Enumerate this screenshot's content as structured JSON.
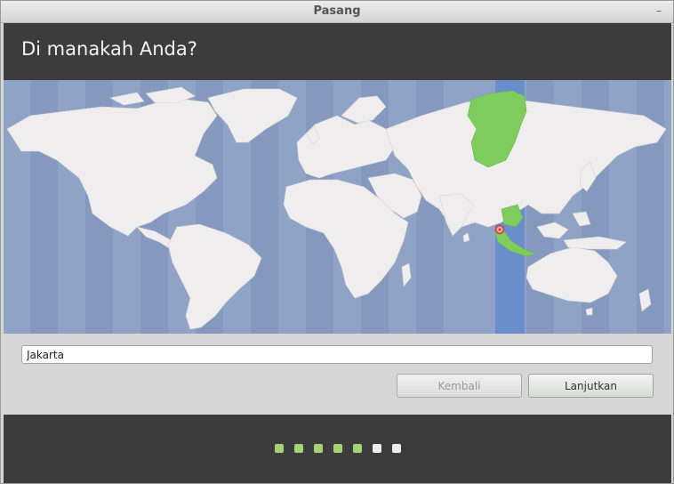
{
  "window": {
    "title": "Pasang",
    "close_glyph": "–"
  },
  "header": {
    "title": "Di manakah Anda?"
  },
  "map": {
    "selected_city": "Jakarta",
    "highlight_color": "#7fcc5e",
    "timezone_band_color": "#6a8ecb"
  },
  "location": {
    "value": "Jakarta"
  },
  "buttons": {
    "back": "Kembali",
    "next": "Lanjutkan"
  },
  "progress": {
    "total_steps": 7,
    "completed_steps": 5,
    "done_color": "#a4d274",
    "todo_color": "#ececec"
  }
}
